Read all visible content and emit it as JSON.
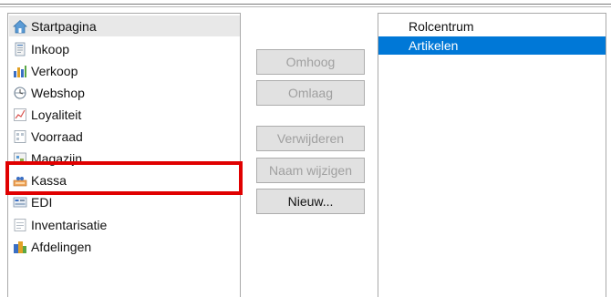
{
  "left_list": {
    "items": [
      {
        "label": "Startpagina",
        "icon": "home-icon",
        "selected": true
      },
      {
        "label": "Inkoop",
        "icon": "purchase-icon",
        "selected": false
      },
      {
        "label": "Verkoop",
        "icon": "sales-chart-icon",
        "selected": false
      },
      {
        "label": "Webshop",
        "icon": "webshop-globe-icon",
        "selected": false
      },
      {
        "label": "Loyaliteit",
        "icon": "loyalty-icon",
        "selected": false
      },
      {
        "label": "Voorraad",
        "icon": "inventory-icon",
        "selected": false
      },
      {
        "label": "Magazijn",
        "icon": "warehouse-icon",
        "selected": false
      },
      {
        "label": "Kassa",
        "icon": "cash-register-icon",
        "selected": false
      },
      {
        "label": "EDI",
        "icon": "edi-icon",
        "selected": false
      },
      {
        "label": "Inventarisatie",
        "icon": "stocktake-icon",
        "selected": false
      },
      {
        "label": "Afdelingen",
        "icon": "departments-icon",
        "selected": false
      }
    ]
  },
  "buttons": {
    "move_up": "Omhoog",
    "move_down": "Omlaag",
    "remove": "Verwijderen",
    "rename": "Naam wijzigen",
    "new": "Nieuw..."
  },
  "right_list": {
    "items": [
      {
        "label": "Rolcentrum",
        "selected": false
      },
      {
        "label": "Artikelen",
        "selected": true
      }
    ]
  },
  "colors": {
    "highlight": "#e00000",
    "selection_blue": "#0078d7",
    "disabled_text": "#a0a0a0"
  }
}
